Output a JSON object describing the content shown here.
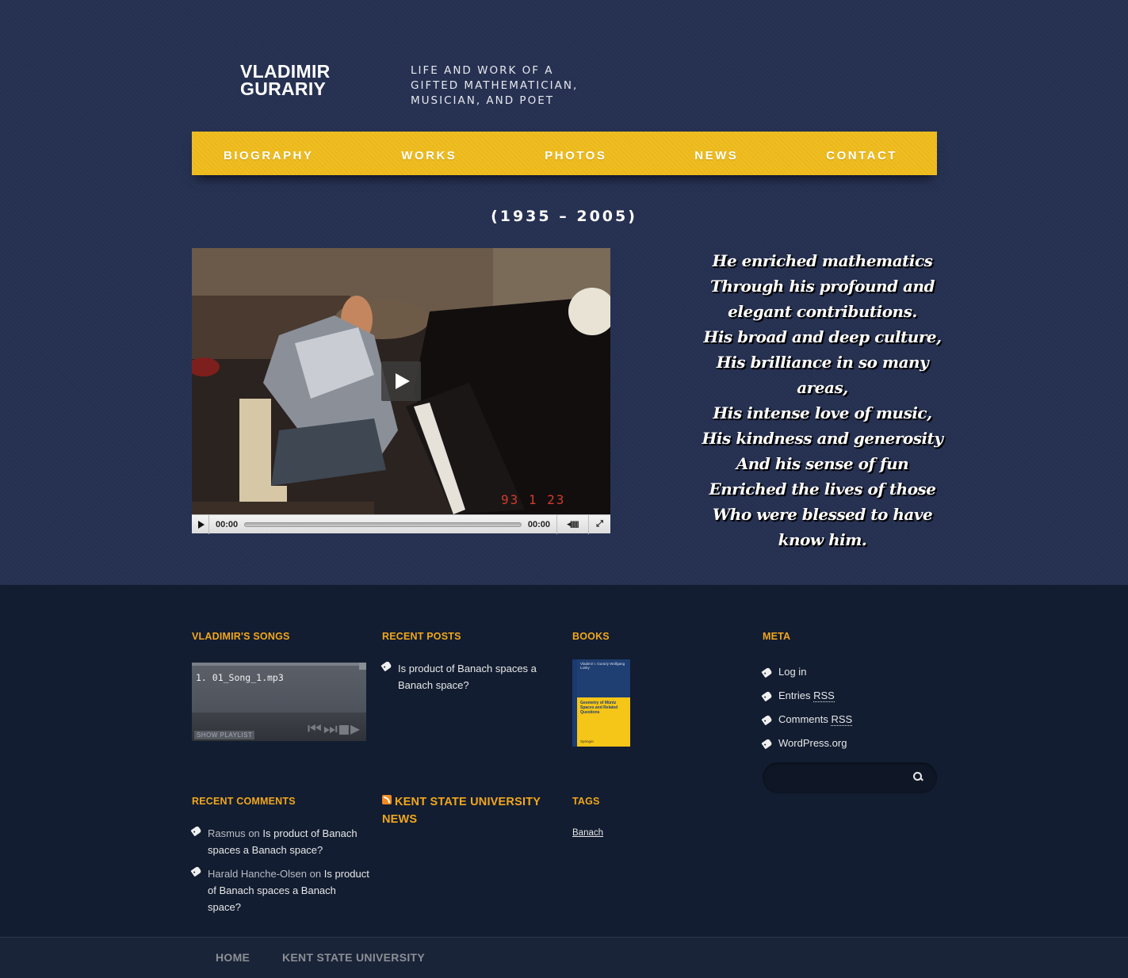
{
  "header": {
    "title_line1": "VLADIMIR",
    "title_line2": "GURARIY",
    "tagline_line1": "LIFE AND WORK OF A",
    "tagline_line2": "GIFTED MATHEMATICIAN,",
    "tagline_line3": "MUSICIAN, AND POET"
  },
  "nav": {
    "items": [
      "BIOGRAPHY",
      "WORKS",
      "PHOTOS",
      "NEWS",
      "CONTACT"
    ]
  },
  "colors": {
    "background": "#263152",
    "nav": "#efbc1c",
    "footer": "#121d31",
    "widget_title": "#f2a71c"
  },
  "main": {
    "years": "(1935 – 2005)",
    "video": {
      "current_time": "00:00",
      "duration": "00:00",
      "date_stamp": "93  1 23",
      "progress": 0
    },
    "poem": [
      "He enriched mathematics",
      "Through his profound and",
      "elegant contributions.",
      "His broad and deep culture,",
      "His brilliance in so many areas,",
      "His intense love of music,",
      "His kindness and generosity",
      "And his sense of fun",
      "Enriched the lives of those",
      "Who were blessed to have",
      "know him."
    ]
  },
  "footer": {
    "songs": {
      "title": "VLADIMIR'S SONGS",
      "track": "1. 01_Song_1.mp3",
      "show_playlist": "SHOW PLAYLIST"
    },
    "recent_posts": {
      "title": "RECENT POSTS",
      "items": [
        "Is product of Banach spaces a Banach space?"
      ]
    },
    "books": {
      "title": "BOOKS",
      "cover_authors": "Vladimir I. Gurariy\nWolfgang Lusky",
      "cover_title": "Geometry of Müntz Spaces and Related Questions",
      "cover_publisher": "Springer"
    },
    "meta": {
      "title": "META",
      "log_in": "Log in",
      "entries_rss": "Entries",
      "comments_rss": "Comments",
      "rss": "RSS",
      "wordpress": "WordPress.org"
    },
    "recent_comments": {
      "title": "RECENT COMMENTS",
      "items": [
        {
          "author": "Rasmus",
          "on": "on",
          "post": "Is product of Banach spaces a Banach space?"
        },
        {
          "author": "Harald Hanche-Olsen",
          "on": "on",
          "post": "Is product of Banach spaces a Banach space?"
        }
      ]
    },
    "kent_news": {
      "title_line1": "KENT STATE UNIVERSITY",
      "title_line2": "NEWS"
    },
    "tags": {
      "title": "TAGS",
      "items": [
        "Banach"
      ]
    }
  },
  "bottom_nav": {
    "items": [
      "HOME",
      "KENT STATE UNIVERSITY"
    ]
  }
}
